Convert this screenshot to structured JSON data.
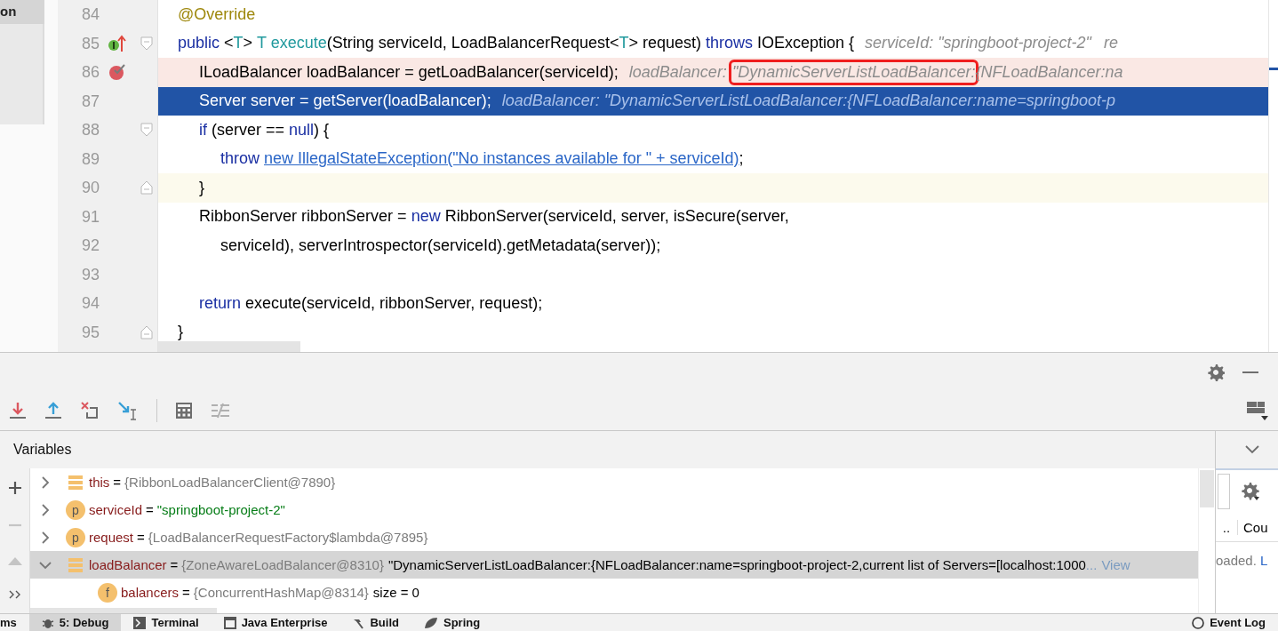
{
  "sidebar": {
    "items": [
      {
        "label": "on",
        "selected": true
      }
    ]
  },
  "editor": {
    "lines": [
      {
        "number": "84",
        "kind": "plain",
        "override_marker": false,
        "fold_start": false,
        "fold_end": false,
        "segments": [
          {
            "text": "@Override",
            "kind": "annotation"
          }
        ]
      },
      {
        "number": "85",
        "kind": "plain",
        "override_marker": true,
        "fold_start": true,
        "fold_end": false,
        "segments": [
          {
            "text": "public",
            "kind": "keyword"
          },
          {
            "text": " <",
            "kind": "plain"
          },
          {
            "text": "T",
            "kind": "type"
          },
          {
            "text": "> ",
            "kind": "plain"
          },
          {
            "text": "T execute",
            "kind": "type"
          },
          {
            "text": "(String serviceId, LoadBalancerRequest<",
            "kind": "plain"
          },
          {
            "text": "T",
            "kind": "type"
          },
          {
            "text": "> request) ",
            "kind": "plain"
          },
          {
            "text": "throws",
            "kind": "keyword"
          },
          {
            "text": " IOException {",
            "kind": "plain"
          },
          {
            "text": "serviceId: \"springboot-project-2\"",
            "kind": "hint"
          },
          {
            "text": "re",
            "kind": "hint"
          }
        ],
        "children": [
          {
            "number": "86",
            "kind": "breakpoint",
            "override_marker": false,
            "fold_start": false,
            "fold_end": false,
            "segments": [
              {
                "text": "ILoadBalancer loadBalancer = getLoadBalancer(serviceId);",
                "kind": "plain"
              },
              {
                "text": "loadBalancer:",
                "kind": "hint"
              },
              {
                "text": "\"DynamicServerListLoadBalancer:",
                "kind": "boxed"
              },
              {
                "text": "{NFLoadBalancer:na",
                "kind": "tail"
              }
            ]
          },
          {
            "number": "87",
            "kind": "current",
            "override_marker": false,
            "fold_start": false,
            "fold_end": false,
            "segments": [
              {
                "text": "Server server = getServer(loadBalancer);",
                "kind": "plain"
              },
              {
                "text": "loadBalancer: \"DynamicServerListLoadBalancer:{NFLoadBalancer:name=springboot-p",
                "kind": "hint"
              }
            ]
          },
          {
            "number": "88",
            "kind": "plain",
            "override_marker": false,
            "fold_start": true,
            "fold_end": false,
            "segments": [
              {
                "text": "if",
                "kind": "keyword"
              },
              {
                "text": " (server == ",
                "kind": "plain"
              },
              {
                "text": "null",
                "kind": "keyword"
              },
              {
                "text": ") {",
                "kind": "plain"
              }
            ],
            "children": [
              {
                "number": "89",
                "kind": "plain",
                "override_marker": false,
                "fold_start": false,
                "fold_end": false,
                "segments": [
                  {
                    "text": "throw",
                    "kind": "keyword"
                  },
                  {
                    "text": "new IllegalStateException(\"No instances available for \" + serviceId)",
                    "kind": "link"
                  },
                  {
                    "text": ";",
                    "kind": "plain"
                  }
                ]
              }
            ]
          },
          {
            "number": "90",
            "kind": "caret",
            "override_marker": false,
            "fold_start": false,
            "fold_end": true,
            "segments": [
              {
                "text": "}",
                "kind": "plain"
              }
            ]
          },
          {
            "number": "91",
            "kind": "plain",
            "override_marker": false,
            "fold_start": false,
            "fold_end": false,
            "segments": [
              {
                "text": "RibbonServer ribbonServer = ",
                "kind": "plain"
              },
              {
                "text": "new",
                "kind": "keyword"
              },
              {
                "text": " RibbonServer(serviceId, server, isSecure(server,",
                "kind": "plain"
              }
            ],
            "children": [
              {
                "number": "92",
                "kind": "plain",
                "override_marker": false,
                "fold_start": false,
                "fold_end": false,
                "segments": [
                  {
                    "text": "serviceId), serverIntrospector(serviceId).getMetadata(server));",
                    "kind": "plain"
                  }
                ]
              }
            ]
          },
          {
            "number": "93",
            "kind": "plain",
            "override_marker": false,
            "fold_start": false,
            "fold_end": false
          },
          {
            "number": "94",
            "kind": "plain",
            "override_marker": false,
            "fold_start": false,
            "fold_end": false,
            "segments": [
              {
                "text": "return",
                "kind": "keyword"
              },
              {
                "text": " execute(serviceId, ribbonServer, request);",
                "kind": "plain"
              }
            ]
          }
        ]
      },
      {
        "number": "95",
        "kind": "plain",
        "override_marker": false,
        "fold_start": false,
        "fold_end": true,
        "segments": [
          {
            "text": "}",
            "kind": "plain"
          }
        ]
      }
    ]
  },
  "debug": {
    "variables_title": "Variables",
    "rows": [
      {
        "kind": "local",
        "expandable": true,
        "expanded": false,
        "name": "this",
        "separator": "=",
        "value": "{RibbonLoadBalancerClient@7890}",
        "selected": false
      },
      {
        "kind": "param",
        "letter": "p",
        "expandable": true,
        "expanded": false,
        "name": "serviceId",
        "separator": "=",
        "string_value": "\"springboot-project-2\"",
        "selected": false
      },
      {
        "kind": "param",
        "letter": "p",
        "expandable": true,
        "expanded": false,
        "name": "request",
        "separator": "=",
        "value": "{LoadBalancerRequestFactory$lambda@7895}",
        "selected": false
      },
      {
        "kind": "local",
        "expandable": true,
        "expanded": true,
        "name": "loadBalancer",
        "separator": "=",
        "value": "{ZoneAwareLoadBalancer@8310}",
        "extra": "\"DynamicServerListLoadBalancer:{NFLoadBalancer:name=springboot-project-2,current list of Servers=[localhost:1000",
        "ellipsis": "...",
        "link": "View",
        "selected": true,
        "children": [
          {
            "kind": "field",
            "letter": "f",
            "expandable": false,
            "name": "balancers",
            "separator": "=",
            "value": "{ConcurrentHashMap@8314}",
            "extra": "size = 0",
            "selected": false
          }
        ]
      }
    ],
    "side_panel": {
      "column_1": "..",
      "column_2": "Cou",
      "text": "oaded.",
      "link": "L"
    }
  },
  "tool_tabs": [
    {
      "label": "ms",
      "selected": false
    },
    {
      "label": "5: Debug",
      "selected": true
    },
    {
      "label": "Terminal",
      "selected": false
    },
    {
      "label": "Java Enterprise",
      "selected": false
    },
    {
      "label": "Build",
      "selected": false
    },
    {
      "label": "Spring",
      "selected": false
    }
  ],
  "event_log": {
    "label": "Event Log"
  }
}
